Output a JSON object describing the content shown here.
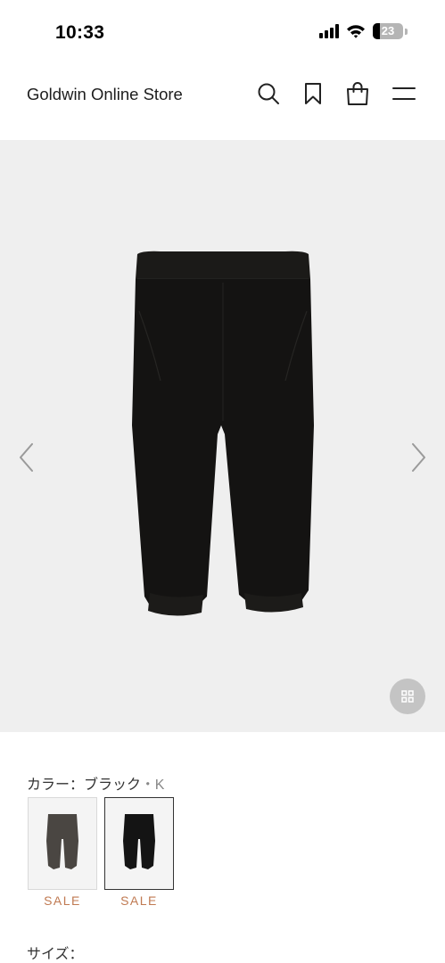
{
  "status_bar": {
    "time": "10:33",
    "battery_level": "23",
    "battery_fraction": 0.23,
    "icons": [
      "signal-icon",
      "wifi-icon",
      "battery-icon"
    ]
  },
  "header": {
    "title": "Goldwin Online Store",
    "icons": [
      "search-icon",
      "bookmark-icon",
      "shopping-bag-icon",
      "menu-icon"
    ]
  },
  "gallery": {
    "image": "black-pants-product-image",
    "prev": "chevron-left-icon",
    "next": "chevron-right-icon",
    "zoom": "grid-icon"
  },
  "color": {
    "label": "カラー：ブラック",
    "code": "・K",
    "swatches": [
      {
        "name": "charcoal",
        "color": "#4a4642",
        "sale": "SALE",
        "selected": false
      },
      {
        "name": "black",
        "color": "#141414",
        "sale": "SALE",
        "selected": true
      }
    ]
  },
  "size": {
    "label": "サイズ："
  },
  "colors": {
    "sale": "#c07a52",
    "gallery_bg": "#efefef",
    "text": "#222222"
  }
}
